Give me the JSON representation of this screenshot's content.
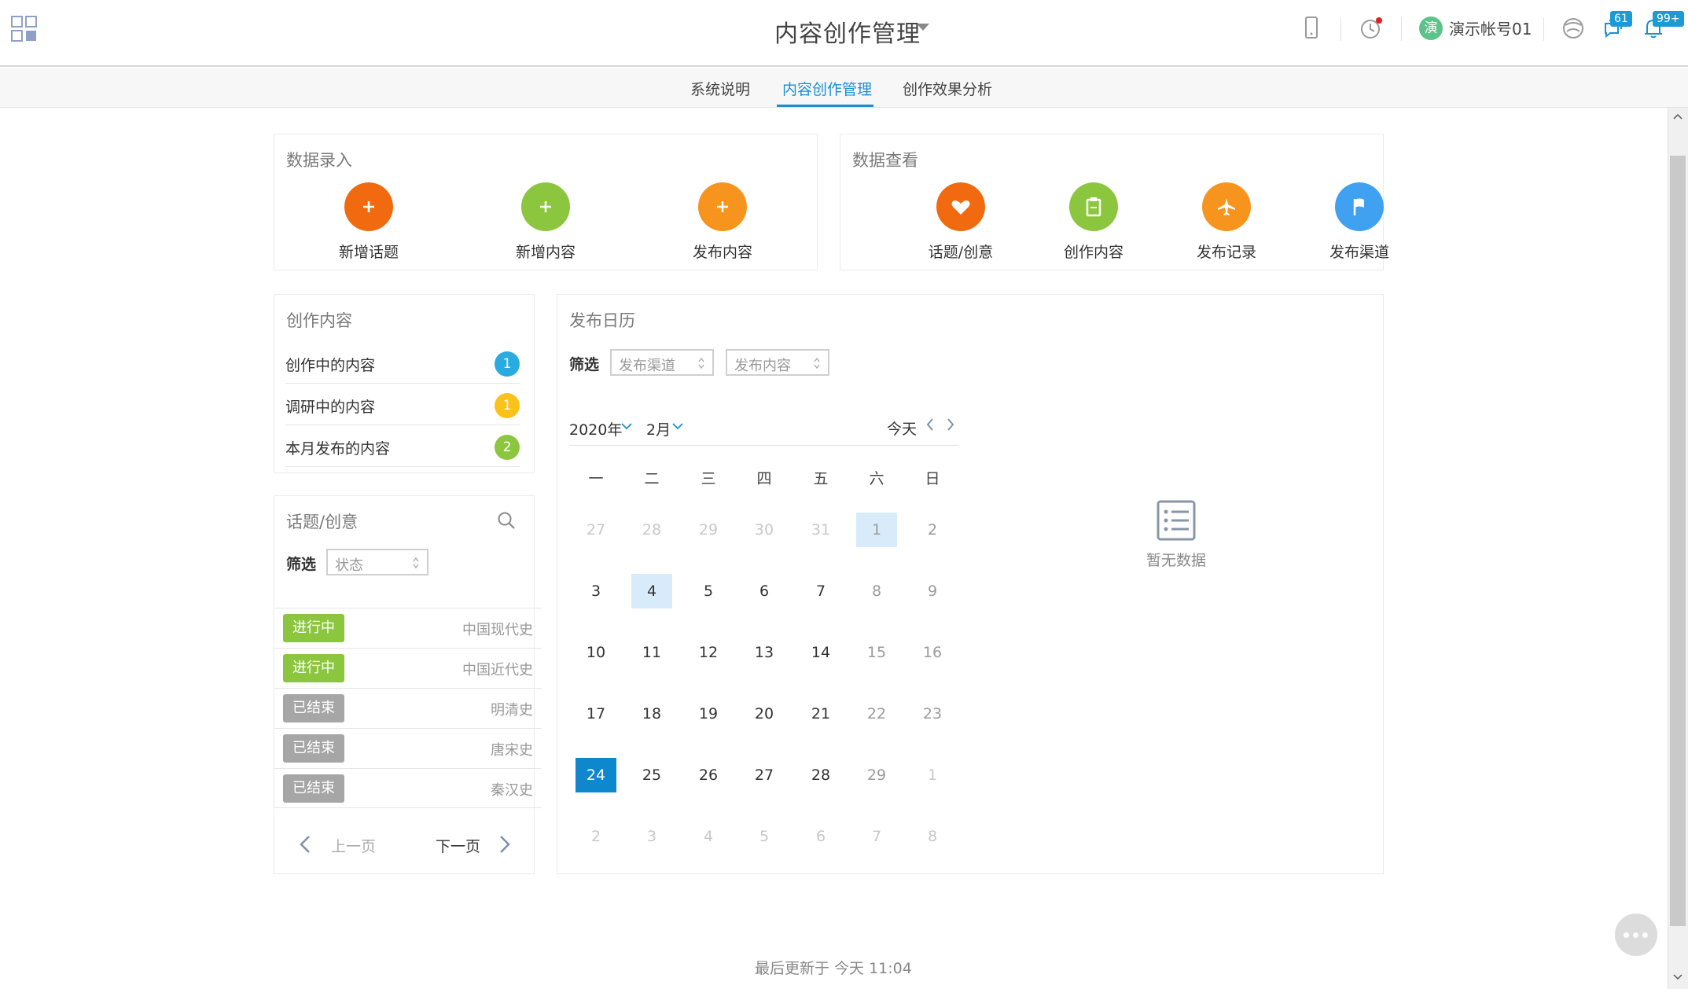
{
  "header": {
    "app_title": "内容创作管理",
    "username": "演示帐号01",
    "avatar_text": "演",
    "messages_badge": "61",
    "notifications_badge": "99+"
  },
  "subnav": {
    "tabs": [
      {
        "label": "系统说明"
      },
      {
        "label": "内容创作管理",
        "active": true
      },
      {
        "label": "创作效果分析"
      }
    ]
  },
  "data_entry": {
    "title": "数据录入",
    "actions": [
      {
        "label": "新增话题",
        "color": "#f26a10",
        "icon": "plus-icon"
      },
      {
        "label": "新增内容",
        "color": "#8cc63f",
        "icon": "plus-icon"
      },
      {
        "label": "发布内容",
        "color": "#f7941d",
        "icon": "plus-icon"
      }
    ]
  },
  "data_view": {
    "title": "数据查看",
    "actions": [
      {
        "label": "话题/创意",
        "color": "#f26a10",
        "icon": "heart-icon"
      },
      {
        "label": "创作内容",
        "color": "#8cc63f",
        "icon": "clipboard-icon"
      },
      {
        "label": "发布记录",
        "color": "#f7941d",
        "icon": "airplane-icon"
      },
      {
        "label": "发布渠道",
        "color": "#3fa1ef",
        "icon": "flag-icon"
      }
    ]
  },
  "creation": {
    "title": "创作内容",
    "items": [
      {
        "label": "创作中的内容",
        "count": "1",
        "color": "#29aae1"
      },
      {
        "label": "调研中的内容",
        "count": "1",
        "color": "#fbc21b"
      },
      {
        "label": "本月发布的内容",
        "count": "2",
        "color": "#8cc63f"
      }
    ]
  },
  "topics": {
    "title": "话题/创意",
    "filter_label": "筛选",
    "status_placeholder": "状态",
    "rows": [
      {
        "status": "进行中",
        "status_color": "#8cc63f",
        "name": "中国现代史"
      },
      {
        "status": "进行中",
        "status_color": "#8cc63f",
        "name": "中国近代史"
      },
      {
        "status": "已结束",
        "status_color": "#a6a6a6",
        "name": "明清史"
      },
      {
        "status": "已结束",
        "status_color": "#a6a6a6",
        "name": "唐宋史"
      },
      {
        "status": "已结束",
        "status_color": "#a6a6a6",
        "name": "秦汉史"
      }
    ],
    "prev_label": "上一页",
    "next_label": "下一页"
  },
  "calendar": {
    "title": "发布日历",
    "filter_label": "筛选",
    "channel_placeholder": "发布渠道",
    "content_placeholder": "发布内容",
    "year": "2020年",
    "month": "2月",
    "today_label": "今天",
    "weekdays": [
      "一",
      "二",
      "三",
      "四",
      "五",
      "六",
      "日"
    ],
    "weeks": [
      [
        "27",
        "28",
        "29",
        "30",
        "31",
        "1",
        "2"
      ],
      [
        "3",
        "4",
        "5",
        "6",
        "7",
        "8",
        "9"
      ],
      [
        "10",
        "11",
        "12",
        "13",
        "14",
        "15",
        "16"
      ],
      [
        "17",
        "18",
        "19",
        "20",
        "21",
        "22",
        "23"
      ],
      [
        "24",
        "25",
        "26",
        "27",
        "28",
        "29",
        "1"
      ],
      [
        "2",
        "3",
        "4",
        "5",
        "6",
        "7",
        "8"
      ]
    ],
    "outside_month": [
      [
        0,
        0
      ],
      [
        0,
        1
      ],
      [
        0,
        2
      ],
      [
        0,
        3
      ],
      [
        0,
        4
      ],
      [
        4,
        6
      ],
      [
        5,
        0
      ],
      [
        5,
        1
      ],
      [
        5,
        2
      ],
      [
        5,
        3
      ],
      [
        5,
        4
      ],
      [
        5,
        5
      ],
      [
        5,
        6
      ]
    ],
    "highlighted": [
      [
        0,
        5
      ],
      [
        1,
        1
      ]
    ],
    "today": [
      4,
      0
    ],
    "empty_text": "暂无数据"
  },
  "footer": {
    "last_updated": "最后更新于 今天 11:04"
  }
}
